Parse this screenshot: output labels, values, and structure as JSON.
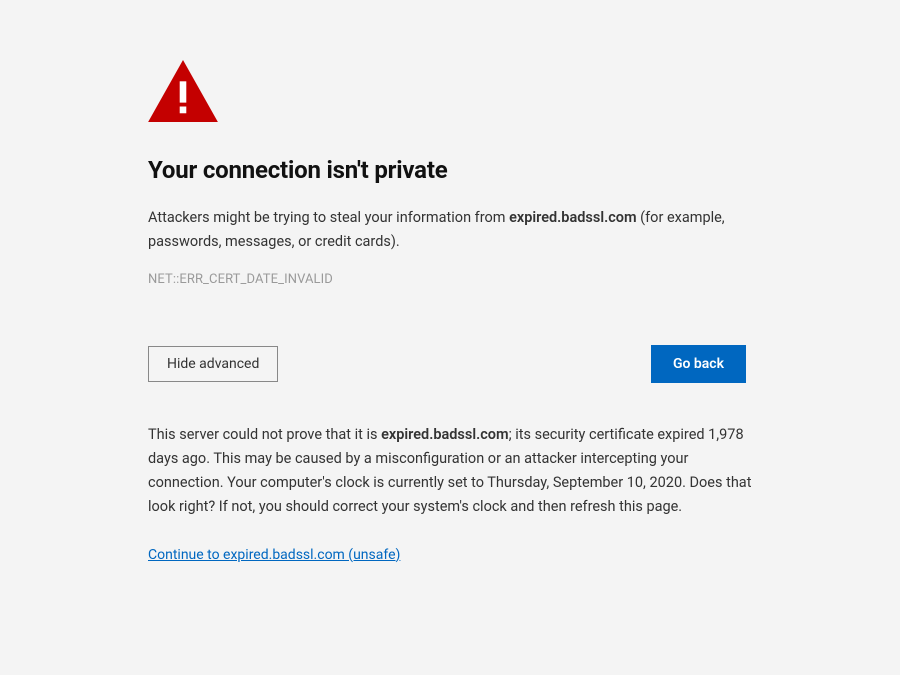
{
  "icon": {
    "name": "warning-triangle",
    "color": "#C40000",
    "mark_color": "#FFFFFF"
  },
  "title": "Your connection isn't private",
  "description": {
    "prefix": "Attackers might be trying to steal your information from ",
    "host": "expired.badssl.com",
    "suffix": " (for example, passwords, messages, or credit cards)."
  },
  "error_code": "NET::ERR_CERT_DATE_INVALID",
  "buttons": {
    "advanced_toggle": "Hide advanced",
    "go_back": "Go back"
  },
  "advanced_detail": {
    "p1_a": "This server could not prove that it is ",
    "host": "expired.badssl.com",
    "p1_b": "; its security certificate expired 1,978 days ago. This may be caused by a misconfiguration or an attacker intercepting your connection. Your computer's clock is currently set to Thursday, September 10, 2020. Does that look right? If not, you should correct your system's clock and then refresh this page."
  },
  "unsafe_link": "Continue to expired.badssl.com (unsafe)",
  "cert": {
    "expired_days_ago": 1978,
    "clock_set_to": "Thursday, September 10, 2020"
  }
}
